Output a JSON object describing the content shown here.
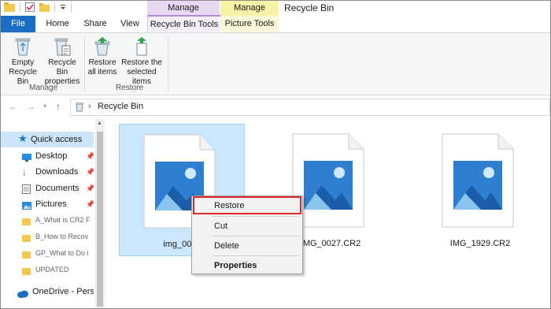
{
  "window": {
    "title": "Recycle Bin"
  },
  "context_groups": [
    "Manage",
    "Manage"
  ],
  "tabs": [
    "File",
    "Home",
    "Share",
    "View",
    "Recycle Bin Tools",
    "Picture Tools"
  ],
  "ribbon": {
    "empty_recycle_bin": [
      "Empty",
      "Recycle Bin"
    ],
    "recycle_bin_properties": [
      "Recycle Bin",
      "properties"
    ],
    "group_manage": "Manage",
    "restore_all": [
      "Restore",
      "all items"
    ],
    "restore_selected": [
      "Restore the",
      "selected items"
    ],
    "group_restore": "Restore"
  },
  "address": {
    "path": "Recycle Bin",
    "separator": "›"
  },
  "nav": {
    "quick_access": "Quick access",
    "items": [
      "Desktop",
      "Downloads",
      "Documents",
      "Pictures"
    ],
    "folders": [
      "A_What is CR2 F",
      "B_How to Recov",
      "GP_What to Do i",
      "UPDATED"
    ],
    "onedrive": "OneDrive - Person"
  },
  "files": [
    {
      "name": "img_0011"
    },
    {
      "name": "IMG_0027.CR2"
    },
    {
      "name": "IMG_1929.CR2"
    }
  ],
  "context_menu": [
    "Restore",
    "Cut",
    "Delete",
    "Properties"
  ]
}
